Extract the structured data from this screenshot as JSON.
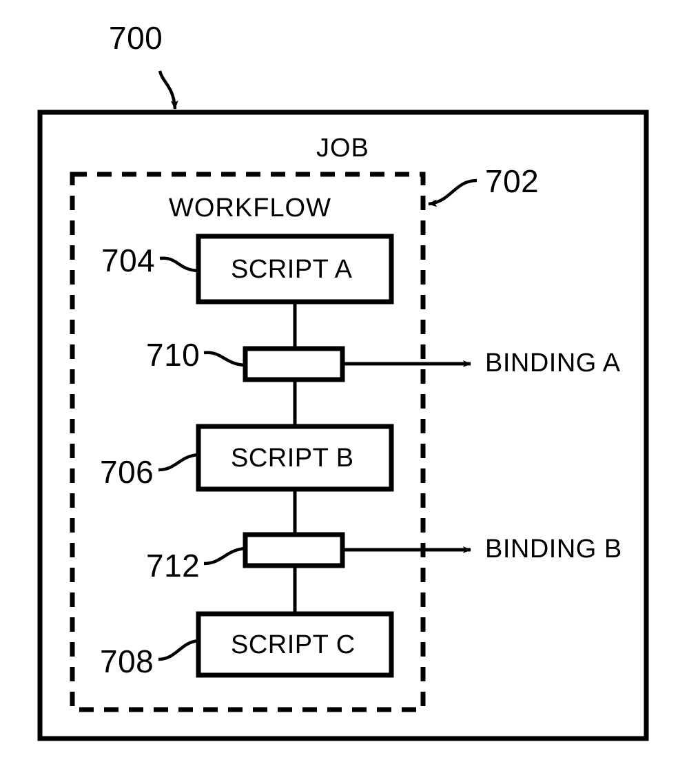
{
  "figure": {
    "reference_numbers": {
      "outer": "700",
      "dashed": "702",
      "script_a": "704",
      "script_b": "706",
      "script_c": "708",
      "binding_box_a": "710",
      "binding_box_b": "712"
    },
    "outer_box_label": "JOB",
    "dashed_box_label": "WORKFLOW",
    "nodes": [
      {
        "id": "script-a",
        "label": "SCRIPT A"
      },
      {
        "id": "binding-node-a",
        "label": ""
      },
      {
        "id": "script-b",
        "label": "SCRIPT B"
      },
      {
        "id": "binding-node-b",
        "label": ""
      },
      {
        "id": "script-c",
        "label": "SCRIPT C"
      }
    ],
    "bindings": [
      {
        "id": "binding-a",
        "label": "BINDING A"
      },
      {
        "id": "binding-b",
        "label": "BINDING B"
      }
    ],
    "colors": {
      "ink": "#000000",
      "paper": "#ffffff"
    }
  }
}
